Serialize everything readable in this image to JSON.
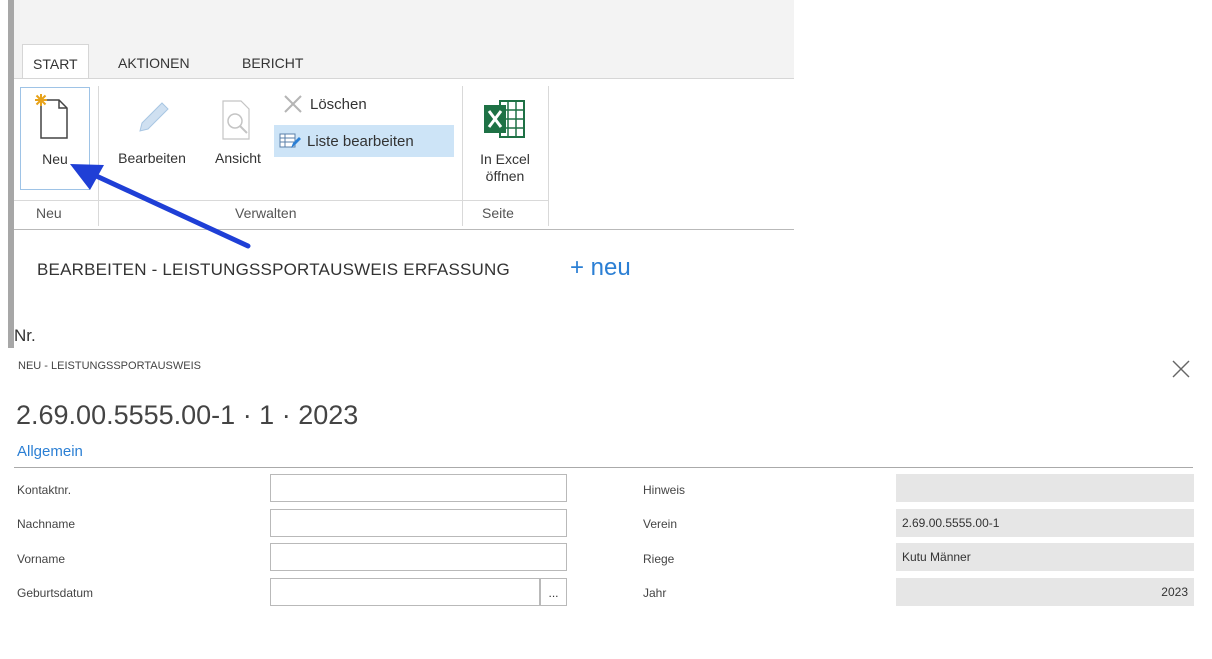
{
  "ribbon": {
    "tabs": [
      "START",
      "AKTIONEN",
      "BERICHT"
    ],
    "buttons": {
      "neu": "Neu",
      "bearbeiten": "Bearbeiten",
      "ansicht": "Ansicht",
      "loeschen": "Löschen",
      "liste_bearbeiten": "Liste bearbeiten",
      "in_excel_line1": "In Excel",
      "in_excel_line2": "öffnen"
    },
    "groups": [
      "Neu",
      "Verwalten",
      "Seite"
    ]
  },
  "page": {
    "heading": "BEARBEITEN - LEISTUNGSSPORTAUSWEIS ERFASSUNG",
    "new_link": "+ neu",
    "nr_label": "Nr."
  },
  "dialog": {
    "subtitle": "NEU - LEISTUNGSSPORTAUSWEIS",
    "title": "2.69.00.5555.00-1 · 1 · 2023",
    "section": "Allgemein",
    "left_fields": [
      {
        "label": "Kontaktnr.",
        "value": ""
      },
      {
        "label": "Nachname",
        "value": ""
      },
      {
        "label": "Vorname",
        "value": ""
      },
      {
        "label": "Geburtsdatum",
        "value": "",
        "button": "..."
      }
    ],
    "right_fields": [
      {
        "label": "Hinweis",
        "value": ""
      },
      {
        "label": "Verein",
        "value": "2.69.00.5555.00-1"
      },
      {
        "label": "Riege",
        "value": "Kutu Männer"
      },
      {
        "label": "Jahr",
        "value": "2023"
      }
    ]
  },
  "colors": {
    "accent": "#2b7fd4",
    "arrow": "#1f3fd6",
    "excel": "#1e7145",
    "readonly": "#e6e6e6"
  }
}
